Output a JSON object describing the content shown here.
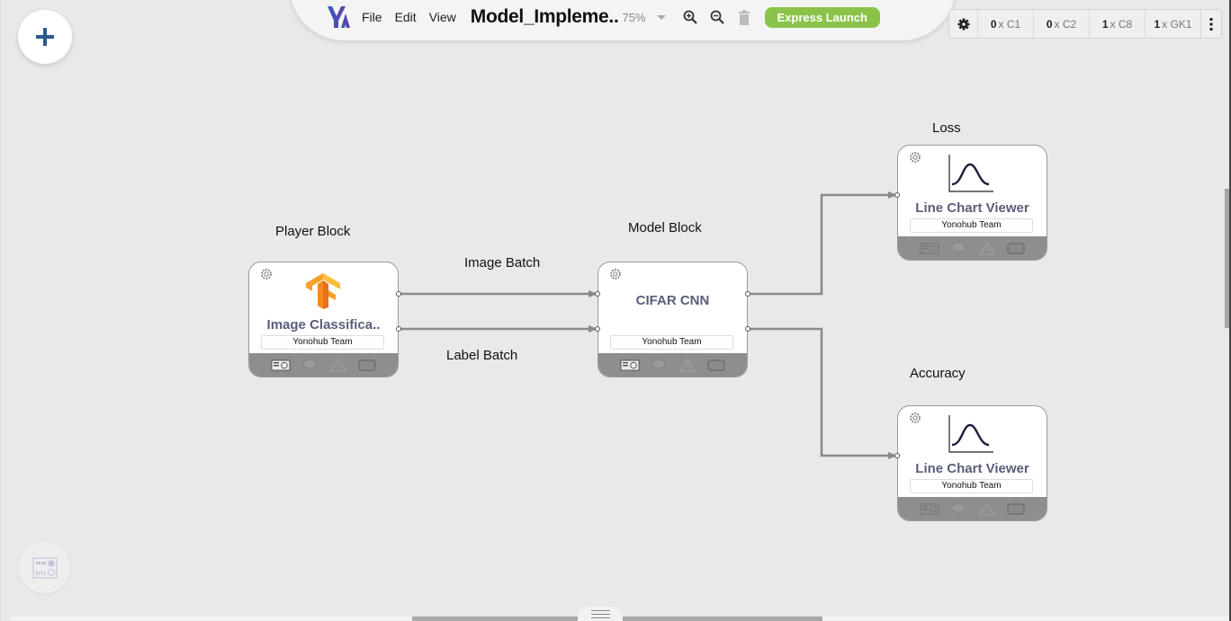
{
  "toolbar": {
    "logo": "YA",
    "menu": [
      "File",
      "Edit",
      "View"
    ],
    "doc_title": "Model_Impleme..",
    "zoom_level": "75%",
    "icons": [
      "zoom-in-icon",
      "zoom-out-icon",
      "trash-icon"
    ],
    "express_launch_label": "Express Launch",
    "accent_color": "#8bc34a"
  },
  "resources": {
    "settings_icon": "gear-icon",
    "items": [
      {
        "count": "0",
        "label": "x C1"
      },
      {
        "count": "0",
        "label": "x C2"
      },
      {
        "count": "1",
        "label": "x C8"
      },
      {
        "count": "1",
        "label": "x GK1"
      }
    ],
    "more_icon": "kebab-icon"
  },
  "add_button": {
    "icon": "plus-icon"
  },
  "dashboard_button": {
    "icon": "dashboard-icon"
  },
  "canvas": {
    "block_labels": {
      "player": "Player Block",
      "model": "Model Block",
      "loss": "Loss",
      "accuracy": "Accuracy"
    },
    "connection_labels": {
      "image_batch": "Image Batch",
      "label_batch": "Label Batch"
    },
    "blocks": [
      {
        "id": "player",
        "title": "Image Classifica..",
        "author": "Yonohub Team",
        "icon": "tensorflow-logo"
      },
      {
        "id": "model",
        "title": "CIFAR CNN",
        "author": "Yonohub Team",
        "icon": ""
      },
      {
        "id": "loss",
        "title": "Line Chart Viewer",
        "author": "Yonohub Team",
        "icon": "line-chart-icon"
      },
      {
        "id": "accuracy",
        "title": "Line Chart Viewer",
        "author": "Yonohub Team",
        "icon": "line-chart-icon"
      }
    ],
    "footer_icons": [
      "gpu-icon",
      "brain-icon",
      "warning-icon",
      "window-icon"
    ]
  }
}
